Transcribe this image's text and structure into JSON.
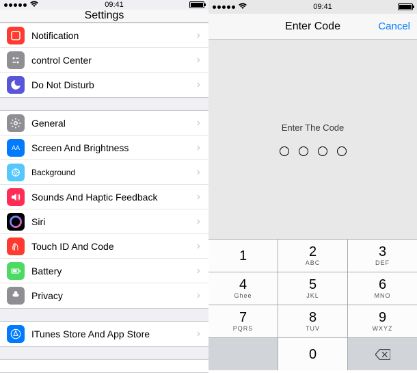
{
  "status": {
    "time": "09:41"
  },
  "left": {
    "title": "Settings",
    "groups": [
      {
        "rows": [
          {
            "label": "Notification",
            "icon": "notification",
            "color": "#ff3b30"
          },
          {
            "label": "control Center",
            "icon": "control-center",
            "color": "#8e8e93"
          },
          {
            "label": "Do Not Disturb",
            "icon": "dnd",
            "color": "#5856d6"
          }
        ]
      },
      {
        "rows": [
          {
            "label": "General",
            "icon": "general",
            "color": "#8e8e93"
          },
          {
            "label": "Screen And Brightness",
            "icon": "brightness",
            "color": "#007aff"
          },
          {
            "label": "Background",
            "icon": "background",
            "color": "#54c7fc",
            "small": true
          },
          {
            "label": "Sounds And Haptic Feedback",
            "icon": "sounds",
            "color": "#ff2d55"
          },
          {
            "label": "Siri",
            "icon": "siri",
            "color": "#000"
          },
          {
            "label": "Touch ID And Code",
            "icon": "touchid",
            "color": "#ff3b30"
          },
          {
            "label": "Battery",
            "icon": "battery",
            "color": "#4cd964"
          },
          {
            "label": "Privacy",
            "icon": "privacy",
            "color": "#8e8e93"
          }
        ]
      },
      {
        "rows": [
          {
            "label": "ITunes Store And App Store",
            "icon": "appstore",
            "color": "#007aff"
          }
        ]
      }
    ]
  },
  "right": {
    "title": "Enter Code",
    "cancel": "Cancel",
    "prompt": "Enter The Code",
    "keypad": [
      {
        "num": "1",
        "letters": ""
      },
      {
        "num": "2",
        "letters": "ABC"
      },
      {
        "num": "3",
        "letters": "DEF"
      },
      {
        "num": "4",
        "letters": "Ghee"
      },
      {
        "num": "5",
        "letters": "JKL"
      },
      {
        "num": "6",
        "letters": "MNO"
      },
      {
        "num": "7",
        "letters": "PQRS"
      },
      {
        "num": "8",
        "letters": "TUV"
      },
      {
        "num": "9",
        "letters": "WXYZ"
      }
    ],
    "zero": "0"
  }
}
